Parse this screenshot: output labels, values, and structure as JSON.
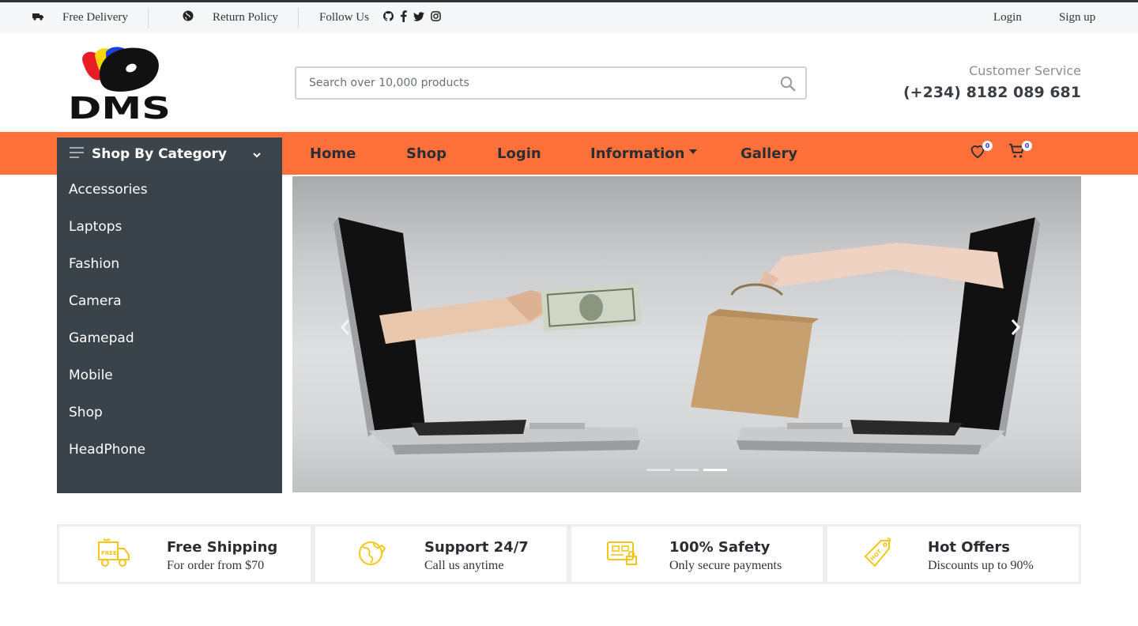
{
  "topbar": {
    "free_delivery": "Free Delivery",
    "return_policy": "Return Policy",
    "follow_us": "Follow Us",
    "login": "Login",
    "signup": "Sign up",
    "social_icons": [
      "github-icon",
      "facebook-icon",
      "twitter-icon",
      "instagram-icon"
    ]
  },
  "header": {
    "logo_text": "DMS",
    "search_placeholder": "Search over 10,000 products",
    "customer_service_label": "Customer Service",
    "phone": "(+234) 8182 089 681"
  },
  "nav": {
    "category_label": "Shop By Category",
    "menu": [
      "Home",
      "Shop",
      "Login",
      "Information",
      "Gallery"
    ],
    "wishlist_count": "0",
    "cart_count": "0"
  },
  "sidebar": {
    "items": [
      "Accessories",
      "Laptops",
      "Fashion",
      "Camera",
      "Gamepad",
      "Mobile",
      "Shop",
      "HeadPhone"
    ]
  },
  "carousel": {
    "slide_count": 3,
    "active_slide": 3
  },
  "features": [
    {
      "title": "Free Shipping",
      "subtitle": "For order from $70",
      "icon": "delivery-truck-icon"
    },
    {
      "title": "Support 24/7",
      "subtitle": "Call us anytime",
      "icon": "globe-support-icon"
    },
    {
      "title": "100% Safety",
      "subtitle": "Only secure payments",
      "icon": "secure-card-icon"
    },
    {
      "title": "Hot Offers",
      "subtitle": "Discounts up to 90%",
      "icon": "hot-tag-icon"
    }
  ],
  "colors": {
    "nav_orange": "#fd703a",
    "sidebar_dark": "#3a424a",
    "feature_yellow": "#f5c518"
  }
}
